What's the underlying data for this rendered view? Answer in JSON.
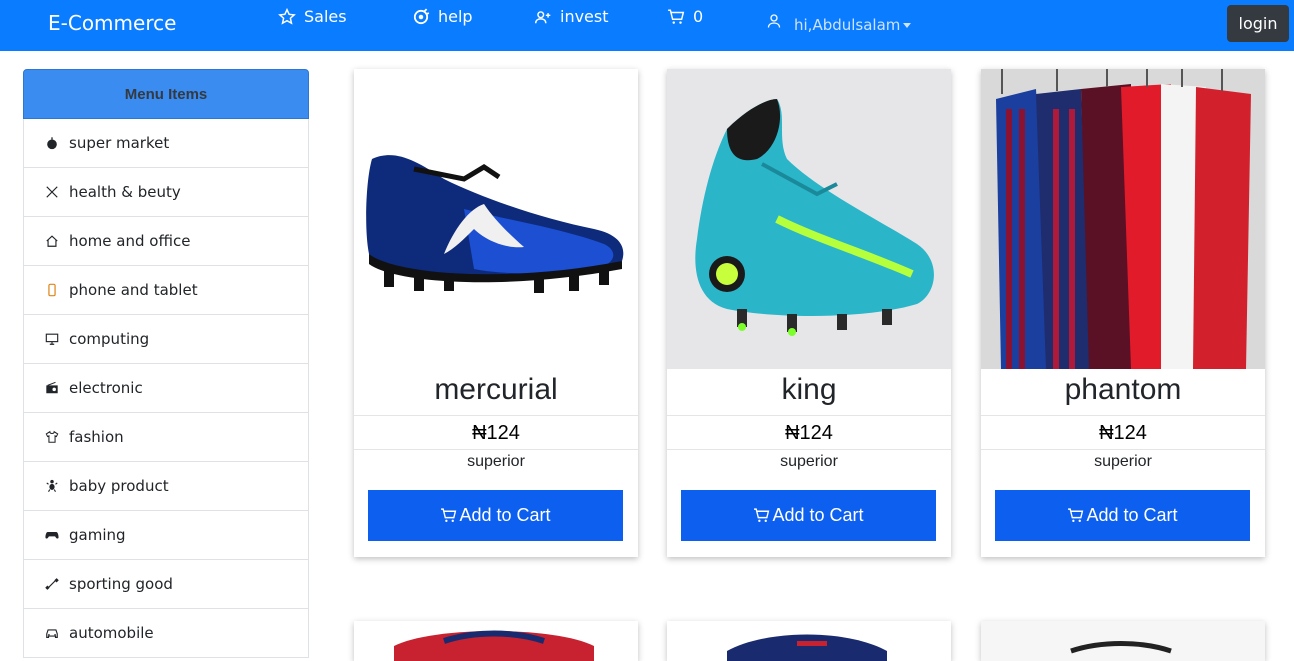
{
  "navbar": {
    "brand": "E-Commerce",
    "items": [
      {
        "label": "Sales",
        "icon": "star-icon"
      },
      {
        "label": "help",
        "icon": "help-gear-icon"
      },
      {
        "label": "invest",
        "icon": "person-plus-icon"
      },
      {
        "label": "0",
        "icon": "cart-icon"
      }
    ],
    "user_greeting": "hi,Abdulsalam",
    "login_label": "login"
  },
  "sidebar": {
    "title": "Menu Items",
    "items": [
      {
        "label": "super market",
        "icon": "apple-icon"
      },
      {
        "label": "health & beuty",
        "icon": "scissors-icon"
      },
      {
        "label": "home and office",
        "icon": "house-icon"
      },
      {
        "label": "phone and tablet",
        "icon": "phone-icon"
      },
      {
        "label": "computing",
        "icon": "monitor-icon"
      },
      {
        "label": "electronic",
        "icon": "radio-icon"
      },
      {
        "label": "fashion",
        "icon": "shirt-icon"
      },
      {
        "label": "baby product",
        "icon": "baby-icon"
      },
      {
        "label": "gaming",
        "icon": "gamepad-icon"
      },
      {
        "label": "sporting good",
        "icon": "dumbbell-icon"
      },
      {
        "label": "automobile",
        "icon": "car-icon"
      }
    ]
  },
  "products": [
    {
      "name": "mercurial",
      "price": "₦124",
      "desc": "superior",
      "button": "Add to Cart"
    },
    {
      "name": "king",
      "price": "₦124",
      "desc": "superior",
      "button": "Add to Cart"
    },
    {
      "name": "phantom",
      "price": "₦124",
      "desc": "superior",
      "button": "Add to Cart"
    }
  ],
  "colors": {
    "navbar": "#0a7cff",
    "sidebar_header": "#3b8cf0",
    "button": "#0d5ff0",
    "login": "#343a40"
  }
}
